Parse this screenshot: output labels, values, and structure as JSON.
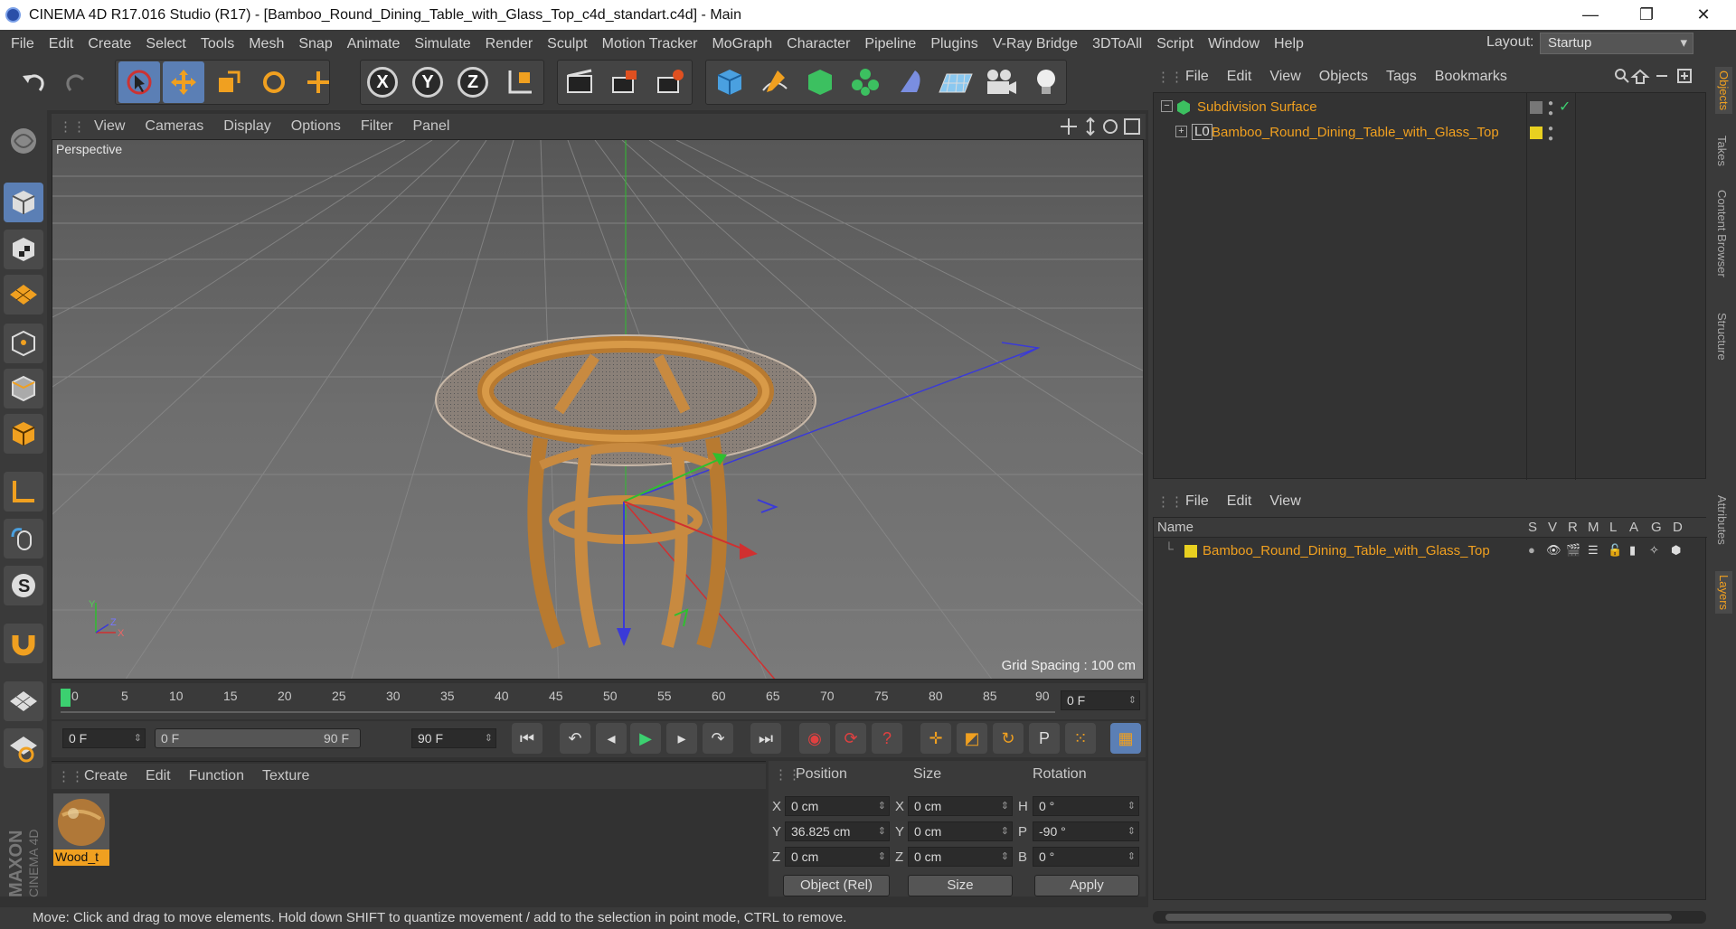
{
  "window": {
    "title": "CINEMA 4D R17.016 Studio (R17) - [Bamboo_Round_Dining_Table_with_Glass_Top_c4d_standart.c4d] - Main",
    "minimize": "—",
    "maximize": "❐",
    "close": "✕"
  },
  "menu": [
    "File",
    "Edit",
    "Create",
    "Select",
    "Tools",
    "Mesh",
    "Snap",
    "Animate",
    "Simulate",
    "Render",
    "Sculpt",
    "Motion Tracker",
    "MoGraph",
    "Character",
    "Pipeline",
    "Plugins",
    "V-Ray Bridge",
    "3DToAll",
    "Script",
    "Window",
    "Help"
  ],
  "layout": {
    "label": "Layout:",
    "value": "Startup"
  },
  "toolbar": {
    "x": "X",
    "y": "Y",
    "z": "Z",
    "render_label": "P"
  },
  "viewport": {
    "menu": [
      "View",
      "Cameras",
      "Display",
      "Options",
      "Filter",
      "Panel"
    ],
    "label": "Perspective",
    "grid_spacing": "Grid Spacing : 100 cm",
    "axis_y": "Y",
    "axis_z": "Z",
    "axis_x": "X"
  },
  "timeline": {
    "ticks": [
      "0",
      "5",
      "10",
      "15",
      "20",
      "25",
      "30",
      "35",
      "40",
      "45",
      "50",
      "55",
      "60",
      "65",
      "70",
      "75",
      "80",
      "85",
      "90"
    ],
    "current": "0 F"
  },
  "playbar": {
    "start": "0 F",
    "range_start": "0 F",
    "range_end": "90 F",
    "end": "90 F"
  },
  "material": {
    "menu": [
      "Create",
      "Edit",
      "Function",
      "Texture"
    ],
    "name": "Wood_t"
  },
  "coords": {
    "headers": [
      "Position",
      "Size",
      "Rotation"
    ],
    "rows": [
      {
        "pl": "X",
        "pv": "0 cm",
        "sl": "X",
        "sv": "0 cm",
        "rl": "H",
        "rv": "0 °"
      },
      {
        "pl": "Y",
        "pv": "36.825 cm",
        "sl": "Y",
        "sv": "0 cm",
        "rl": "P",
        "rv": "-90 °"
      },
      {
        "pl": "Z",
        "pv": "0 cm",
        "sl": "Z",
        "sv": "0 cm",
        "rl": "B",
        "rv": "0 °"
      }
    ],
    "mode": "Object (Rel)",
    "size_mode": "Size",
    "apply": "Apply"
  },
  "objects": {
    "menu": [
      "File",
      "Edit",
      "View",
      "Objects",
      "Tags",
      "Bookmarks"
    ],
    "items": [
      "Subdivision Surface",
      "Bamboo_Round_Dining_Table_with_Glass_Top"
    ],
    "level_badge": "L0"
  },
  "layers": {
    "menu": [
      "File",
      "Edit",
      "View"
    ],
    "name_header": "Name",
    "cols": [
      "S",
      "V",
      "R",
      "M",
      "L",
      "A",
      "G",
      "D"
    ],
    "item": "Bamboo_Round_Dining_Table_with_Glass_Top"
  },
  "sidetabs": [
    "Objects",
    "Takes",
    "Content Browser",
    "Structure",
    "Attributes",
    "Layers"
  ],
  "status": "Move: Click and drag to move elements. Hold down SHIFT to quantize movement / add to the selection in point mode, CTRL to remove.",
  "colors": {
    "accent": "#5b7fb5",
    "orange": "#f0a020",
    "layer": "#e8d020"
  }
}
